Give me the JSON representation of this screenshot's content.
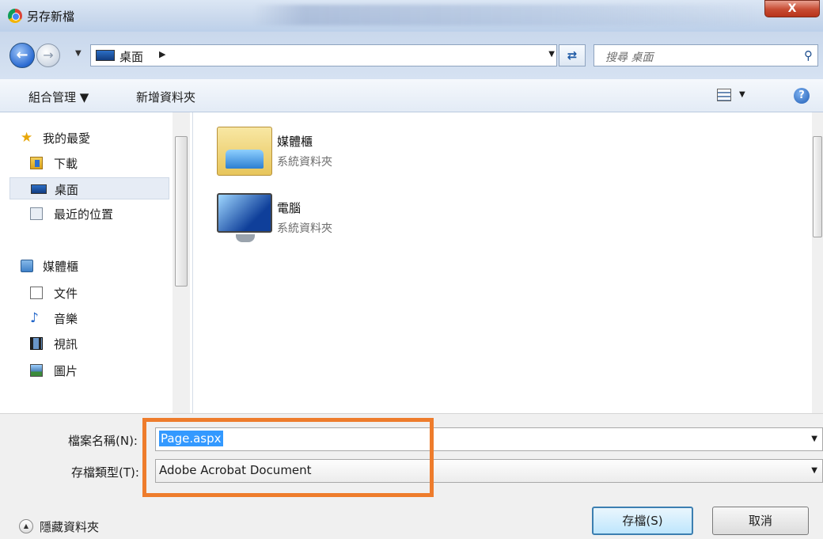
{
  "window": {
    "title": "另存新檔",
    "close_label": "X"
  },
  "address": {
    "crumb": "桌面",
    "search_placeholder": "搜尋 桌面"
  },
  "toolbar": {
    "organize": "組合管理 ▼",
    "new_folder": "新增資料夾",
    "help": "?"
  },
  "sidebar": {
    "items": [
      {
        "label": "我的最愛",
        "icon": "star-icon"
      },
      {
        "label": "下載",
        "icon": "downloads-icon"
      },
      {
        "label": "桌面",
        "icon": "desktop-icon"
      },
      {
        "label": "最近的位置",
        "icon": "recent-places-icon"
      },
      {
        "label": "媒體櫃",
        "icon": "library-icon"
      },
      {
        "label": "文件",
        "icon": "documents-icon"
      },
      {
        "label": "音樂",
        "icon": "music-icon"
      },
      {
        "label": "視訊",
        "icon": "video-icon"
      },
      {
        "label": "圖片",
        "icon": "pictures-icon"
      }
    ]
  },
  "content": {
    "items": [
      {
        "name": "媒體櫃",
        "type": "系統資料夾",
        "icon": "library-folder-icon"
      },
      {
        "name": "電腦",
        "type": "系統資料夾",
        "icon": "computer-icon"
      }
    ]
  },
  "form": {
    "filename_label": "檔案名稱(N):",
    "filename_value": "Page.aspx",
    "filetype_label": "存檔類型(T):",
    "filetype_value": "Adobe Acrobat Document"
  },
  "footer": {
    "hide_folders": "隱藏資料夾",
    "save": "存檔(S)",
    "cancel": "取消"
  },
  "colors": {
    "highlight": "#ee7c2c",
    "selection": "#3399ff"
  }
}
